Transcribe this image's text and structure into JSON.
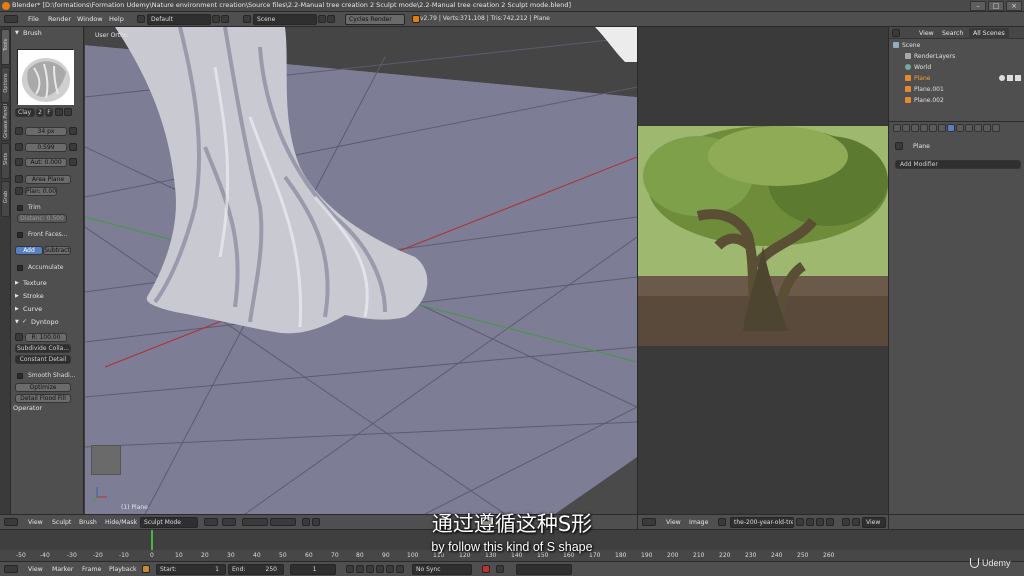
{
  "window": {
    "title": "Blender* [D:\\formations\\Formation Udemy\\Nature environment creation\\Source files\\2.2-Manual tree creation 2 Sculpt mode\\2.2-Manual tree creation 2 Sculpt mode.blend]",
    "controls": [
      "–",
      "□",
      "×"
    ]
  },
  "infobar": {
    "menus": [
      "File",
      "Render",
      "Window",
      "Help"
    ],
    "layout": "Default",
    "scene": "Scene",
    "engine": "Cycles Render",
    "stats": "v2.79 | Verts:371,108 | Tris:742,212 | Plane"
  },
  "tabs": [
    "Tools",
    "Options",
    "Grease Pencil",
    "Slots",
    "Grab"
  ],
  "toolshelf": {
    "brush_header": "Brush",
    "brush_name": "Clay",
    "brush_users": "2",
    "brush_fake": "F",
    "radius": "34 px",
    "strength": "0.599",
    "autosmooth": "Aut: 0.000",
    "plane_mode": "Area Plane",
    "plane_offset": "Plan: 0.000",
    "trim_label": "Trim",
    "trim_distance": "Distanc: 0.500",
    "front_faces": "Front Faces...",
    "add": "Add",
    "subtract": "Subtract",
    "accumulate": "Accumulate",
    "texture": "Texture",
    "stroke": "Stroke",
    "curve": "Curve",
    "dyntopo": "Dyntopo",
    "resolution": "R: 100.00",
    "subdiv_mode": "Subdivide Colla...",
    "detail_mode": "Constant Detail",
    "smooth_shading": "Smooth Shadi...",
    "optimize": "Optimize",
    "detail_flood": "Detail Flood Fill",
    "operator": "Operator"
  },
  "viewport": {
    "view_label": "User Ortho",
    "object_label": "(1) Plane"
  },
  "outliner": {
    "header_view": "View",
    "header_search": "Search",
    "header_scenes": "All Scenes",
    "rows": [
      "Scene",
      "RenderLayers",
      "World",
      "Plane",
      "Plane.001",
      "Plane.002"
    ]
  },
  "properties": {
    "object": "Plane",
    "add_modifier": "Add Modifier"
  },
  "vp_header": {
    "items": [
      "View",
      "Sculpt",
      "Brush",
      "Hide/Mask"
    ],
    "mode": "Sculpt Mode"
  },
  "img_header": {
    "items": [
      "View",
      "Image"
    ],
    "image_name": "the-200-year-old-tre...",
    "view_btn": "View"
  },
  "timeline": {
    "ticks": [
      "-50",
      "-40",
      "-30",
      "-20",
      "-10",
      "0",
      "10",
      "20",
      "30",
      "40",
      "50",
      "60",
      "70",
      "80",
      "90",
      "100",
      "110",
      "120",
      "130",
      "140",
      "150",
      "160",
      "170",
      "180",
      "190",
      "200",
      "210",
      "220",
      "230",
      "240",
      "250",
      "260"
    ],
    "menus": [
      "View",
      "Marker",
      "Frame",
      "Playback"
    ],
    "start": "Start:",
    "start_val": "1",
    "end": "End:",
    "end_val": "250",
    "current": "1",
    "sync": "No Sync"
  },
  "subtitles": {
    "zh": "通过遵循这种S形",
    "en": "by follow this kind of S shape"
  },
  "watermark": "Udemy",
  "colors": {
    "accent_blue": "#5680c2",
    "brand_orange": "#e87d0d",
    "viewport_grid": "#8a8aa0"
  }
}
